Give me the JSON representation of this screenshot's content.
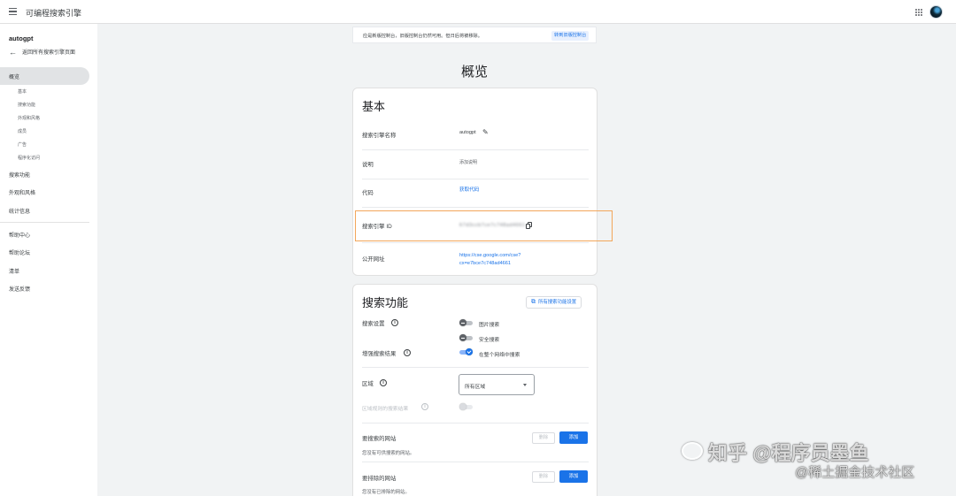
{
  "header": {
    "title": "可编程搜索引擎",
    "menu_icon": "hamburger-menu-icon",
    "apps_icon": "google-apps-icon"
  },
  "sidebar": {
    "project_name": "autogpt",
    "back_label": "返回所有搜索引擎页面",
    "items": [
      {
        "label": "概览",
        "active": true
      },
      {
        "label": "基本",
        "sub": true
      },
      {
        "label": "搜索功能",
        "sub": true
      },
      {
        "label": "外观和风格",
        "sub": true
      },
      {
        "label": "成员",
        "sub": true
      },
      {
        "label": "广告",
        "sub": true
      },
      {
        "label": "程序化访问",
        "sub": true
      },
      {
        "label": "搜索功能"
      },
      {
        "label": "外观和风格"
      },
      {
        "label": "统计信息"
      },
      {
        "label": "帮助中心"
      },
      {
        "label": "帮助论坛"
      },
      {
        "label": "清单"
      },
      {
        "label": "发送反馈"
      }
    ]
  },
  "banner": {
    "text": "应是新版控制台，旧版控制台仍然可用。但日后将被移除。",
    "button": "转到旧版控制台"
  },
  "page_title": "概览",
  "basic_card": {
    "title": "基本",
    "rows": {
      "name_label": "搜索引擎名称",
      "name_value": "autogpt",
      "desc_label": "说明",
      "desc_value": "添加说明",
      "code_label": "代码",
      "code_value": "获取代码",
      "id_label": "搜索引擎 ID",
      "id_value": "67d3ccb7ce7c748ad4661",
      "url_label": "公开网址",
      "url_line1": "https://cse.google.com/cse?",
      "url_line2": "cx=e7bce7c748ad4661"
    }
  },
  "search_card": {
    "title": "搜索功能",
    "settings_button": "所有搜索功能设置",
    "search_settings_label": "搜索设置",
    "image_search": "图片搜索",
    "safe_search": "安全搜索",
    "enhanced_label": "增强搜索结果",
    "whole_web": "在整个网络中搜索",
    "region_label": "区域",
    "region_value": "所有区域",
    "region_boost_label": "区域规则的搜索结果",
    "sites_label": "要搜索的网站",
    "sites_desc": "您没有可供搜索的网站。",
    "exclude_label": "要排除的网站",
    "exclude_desc": "您没有已排除的网站。",
    "delete_btn": "删除",
    "add_btn": "添加"
  },
  "watermark": {
    "line1": "知乎 @程序员墨鱼",
    "line2": "@稀土掘金技术社区"
  }
}
